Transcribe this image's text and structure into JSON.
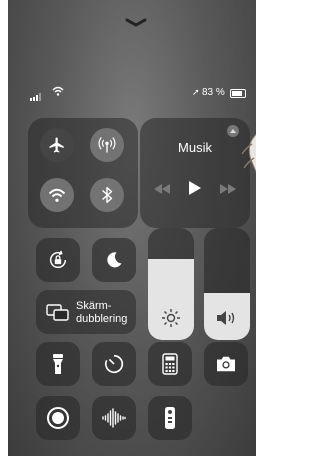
{
  "status": {
    "location_symbol": "➚",
    "battery_text": "83 %",
    "battery_level": 0.83
  },
  "now_playing": {
    "title": "Musik"
  },
  "screen_mirroring": {
    "label": "Skärm-\ndubblering"
  },
  "sliders": {
    "brightness_level": 0.72,
    "volume_level": 0.42
  },
  "colors": {
    "connectivity_active": "#3d3d3d",
    "tile_bg": "#2a2a2a",
    "icon": "#ffffff"
  }
}
